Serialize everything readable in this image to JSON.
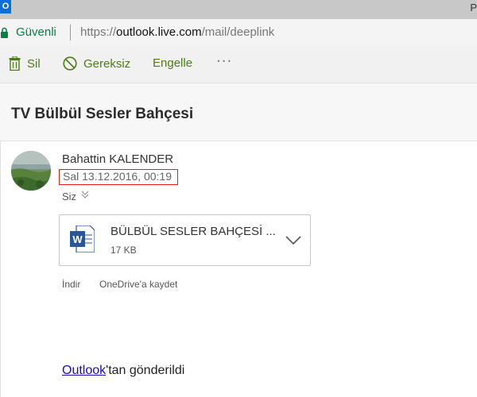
{
  "titlebar": {
    "icon_letter": "O",
    "title_fragment": "P"
  },
  "address_bar": {
    "secure_label": "Güvenli",
    "url_scheme": "https://",
    "url_host": "outlook.live.com",
    "url_path": "/mail/deeplink"
  },
  "toolbar": {
    "delete_label": "Sil",
    "junk_label": "Gereksiz",
    "block_label": "Engelle",
    "more_label": "···"
  },
  "message": {
    "subject": "TV Bülbül Sesler Bahçesi",
    "sender": "Bahattin KALENDER",
    "date": "Sal 13.12.2016, 00:19",
    "to": "Siz",
    "attachment": {
      "name": "BÜLBÜL SESLER BAHÇESİ ...",
      "size": "17 KB",
      "type_icon_letter": "W"
    },
    "download_label": "İndir",
    "save_onedrive_label": "OneDrive'a kaydet",
    "signature_link": "Outlook",
    "signature_rest": "'tan gönderildi"
  },
  "colors": {
    "accent_green": "#4c7a1c",
    "secure_green": "#0b8043",
    "word_blue": "#2b579a",
    "highlight_red": "#e02020",
    "link_blue": "#1a0dab"
  },
  "icons": [
    "outlook-icon",
    "lock-icon",
    "trash-icon",
    "block-icon",
    "more-icon",
    "chevron-down-icon",
    "word-file-icon",
    "avatar"
  ]
}
